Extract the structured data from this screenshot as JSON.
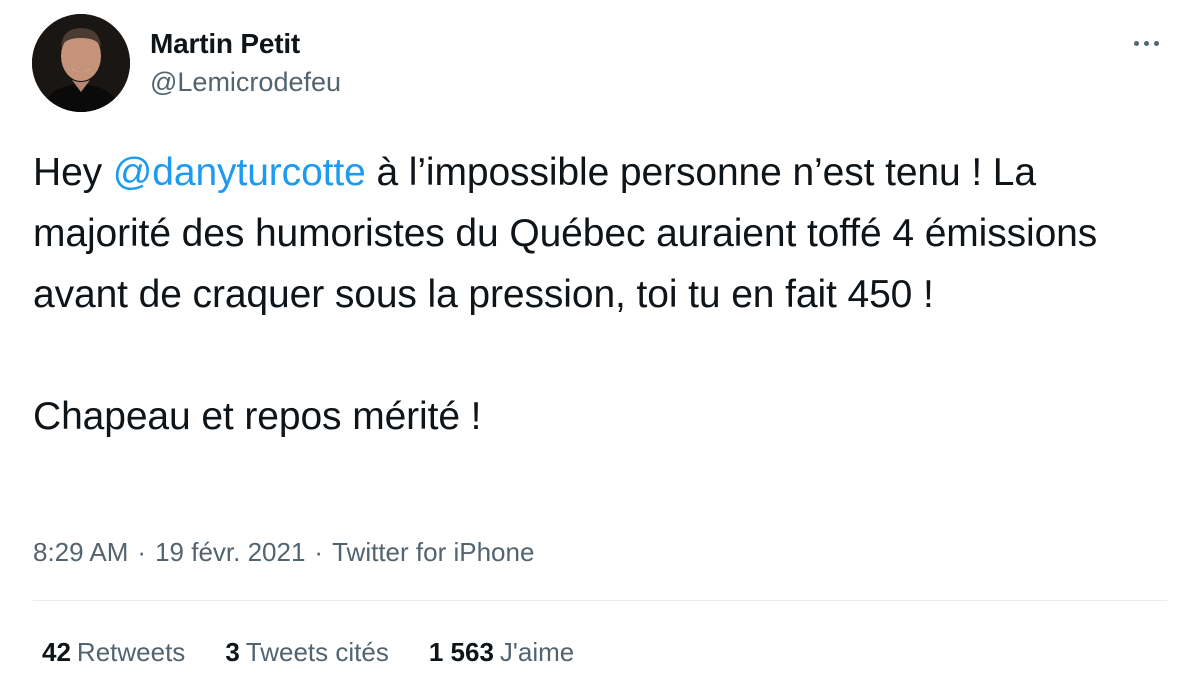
{
  "author": {
    "name": "Martin Petit",
    "handle": "@Lemicrodefeu",
    "avatar_icon": "person-photo-icon"
  },
  "more_icon": "more-dots-icon",
  "tweet": {
    "text_before_mention": "Hey ",
    "mention": "@danyturcotte",
    "text_after_mention": " à l’impossible personne n’est tenu ! La majorité des humoristes du Québec auraient toffé 4 émissions avant de craquer sous la pression, toi tu en fait 450 !",
    "second_paragraph": "Chapeau et repos mérité !"
  },
  "meta": {
    "time": "8:29 AM",
    "separator": "·",
    "date": "19 févr. 2021",
    "source": "Twitter for iPhone"
  },
  "stats": {
    "retweets_count": "42",
    "retweets_label": "Retweets",
    "quotes_count": "3",
    "quotes_label": "Tweets cités",
    "likes_count": "1 563",
    "likes_label": "J'aime"
  },
  "colors": {
    "text": "#0f1419",
    "secondary": "#536471",
    "link": "#1d9bf0",
    "divider": "#e6ecf0"
  }
}
